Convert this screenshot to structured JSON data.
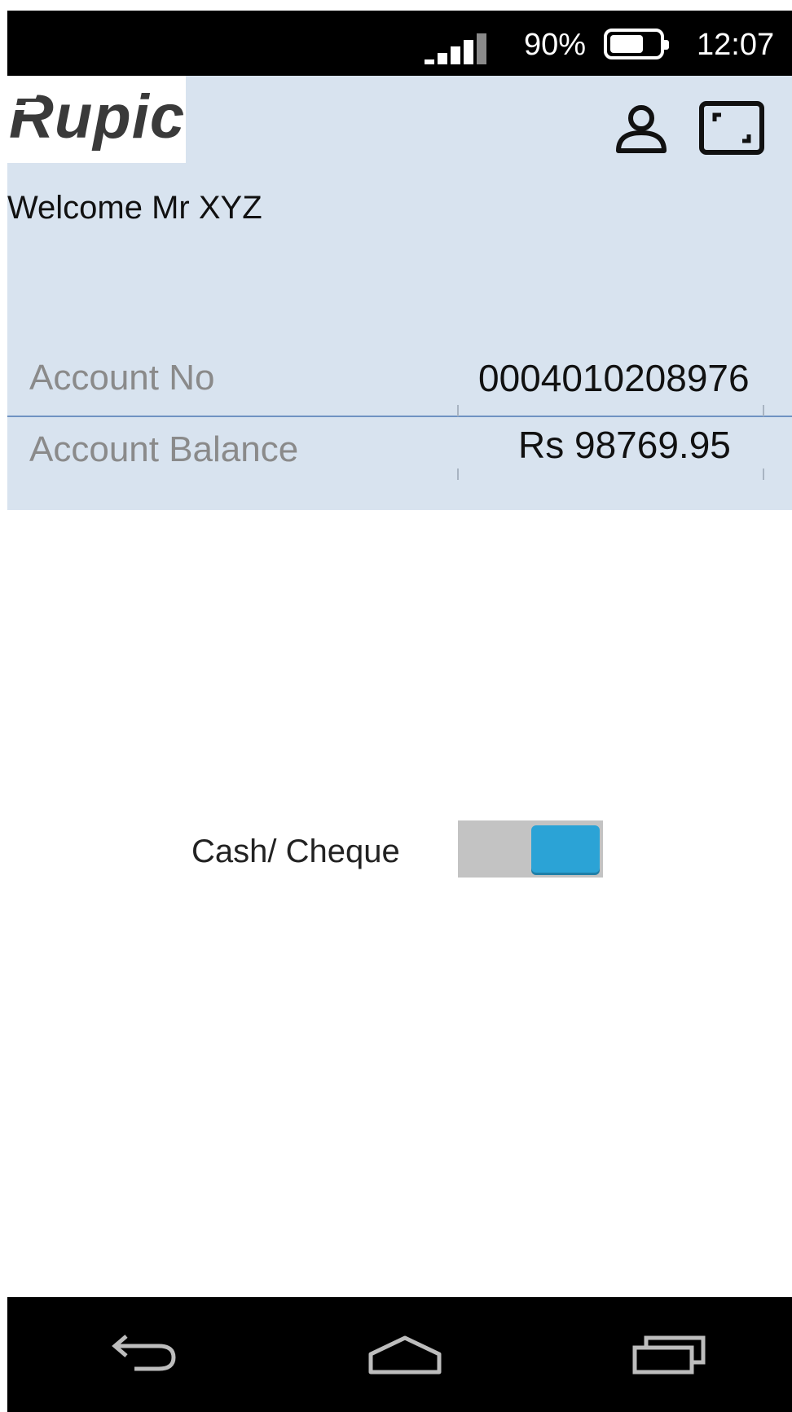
{
  "status_bar": {
    "battery_percent": "90%",
    "time": "12:07",
    "signal_icon": "signal-icon",
    "battery_icon": "battery-icon"
  },
  "header": {
    "logo_text": "Rupic",
    "icons": [
      "user-icon",
      "fullscreen-icon"
    ],
    "welcome": "Welcome Mr XYZ",
    "background": "#d8e3ef"
  },
  "account": {
    "number_label": "Account No",
    "number_value": "0004010208976",
    "balance_label": "Account Balance",
    "balance_value": "Rs 98769.95"
  },
  "payment_mode": {
    "label": "Cash/ Cheque",
    "toggle_color": "#2ba3d6"
  },
  "nav_bar": {
    "icons": [
      "back-icon",
      "home-icon",
      "recents-icon"
    ]
  }
}
